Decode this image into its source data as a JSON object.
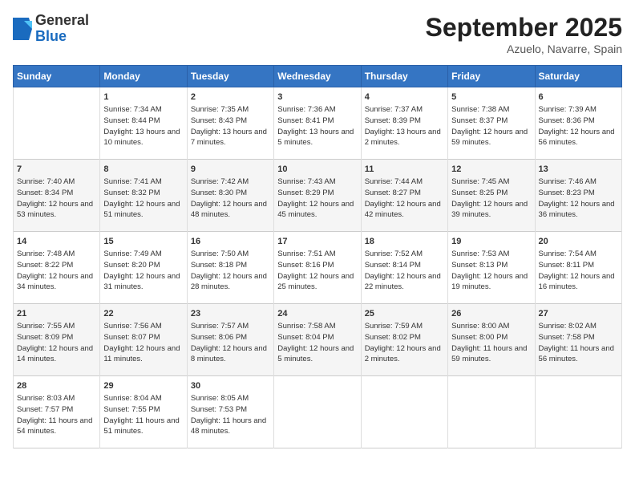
{
  "logo": {
    "general": "General",
    "blue": "Blue"
  },
  "header": {
    "month": "September 2025",
    "location": "Azuelo, Navarre, Spain"
  },
  "weekdays": [
    "Sunday",
    "Monday",
    "Tuesday",
    "Wednesday",
    "Thursday",
    "Friday",
    "Saturday"
  ],
  "weeks": [
    [
      {
        "day": "",
        "sunrise": "",
        "sunset": "",
        "daylight": ""
      },
      {
        "day": "1",
        "sunrise": "Sunrise: 7:34 AM",
        "sunset": "Sunset: 8:44 PM",
        "daylight": "Daylight: 13 hours and 10 minutes."
      },
      {
        "day": "2",
        "sunrise": "Sunrise: 7:35 AM",
        "sunset": "Sunset: 8:43 PM",
        "daylight": "Daylight: 13 hours and 7 minutes."
      },
      {
        "day": "3",
        "sunrise": "Sunrise: 7:36 AM",
        "sunset": "Sunset: 8:41 PM",
        "daylight": "Daylight: 13 hours and 5 minutes."
      },
      {
        "day": "4",
        "sunrise": "Sunrise: 7:37 AM",
        "sunset": "Sunset: 8:39 PM",
        "daylight": "Daylight: 13 hours and 2 minutes."
      },
      {
        "day": "5",
        "sunrise": "Sunrise: 7:38 AM",
        "sunset": "Sunset: 8:37 PM",
        "daylight": "Daylight: 12 hours and 59 minutes."
      },
      {
        "day": "6",
        "sunrise": "Sunrise: 7:39 AM",
        "sunset": "Sunset: 8:36 PM",
        "daylight": "Daylight: 12 hours and 56 minutes."
      }
    ],
    [
      {
        "day": "7",
        "sunrise": "Sunrise: 7:40 AM",
        "sunset": "Sunset: 8:34 PM",
        "daylight": "Daylight: 12 hours and 53 minutes."
      },
      {
        "day": "8",
        "sunrise": "Sunrise: 7:41 AM",
        "sunset": "Sunset: 8:32 PM",
        "daylight": "Daylight: 12 hours and 51 minutes."
      },
      {
        "day": "9",
        "sunrise": "Sunrise: 7:42 AM",
        "sunset": "Sunset: 8:30 PM",
        "daylight": "Daylight: 12 hours and 48 minutes."
      },
      {
        "day": "10",
        "sunrise": "Sunrise: 7:43 AM",
        "sunset": "Sunset: 8:29 PM",
        "daylight": "Daylight: 12 hours and 45 minutes."
      },
      {
        "day": "11",
        "sunrise": "Sunrise: 7:44 AM",
        "sunset": "Sunset: 8:27 PM",
        "daylight": "Daylight: 12 hours and 42 minutes."
      },
      {
        "day": "12",
        "sunrise": "Sunrise: 7:45 AM",
        "sunset": "Sunset: 8:25 PM",
        "daylight": "Daylight: 12 hours and 39 minutes."
      },
      {
        "day": "13",
        "sunrise": "Sunrise: 7:46 AM",
        "sunset": "Sunset: 8:23 PM",
        "daylight": "Daylight: 12 hours and 36 minutes."
      }
    ],
    [
      {
        "day": "14",
        "sunrise": "Sunrise: 7:48 AM",
        "sunset": "Sunset: 8:22 PM",
        "daylight": "Daylight: 12 hours and 34 minutes."
      },
      {
        "day": "15",
        "sunrise": "Sunrise: 7:49 AM",
        "sunset": "Sunset: 8:20 PM",
        "daylight": "Daylight: 12 hours and 31 minutes."
      },
      {
        "day": "16",
        "sunrise": "Sunrise: 7:50 AM",
        "sunset": "Sunset: 8:18 PM",
        "daylight": "Daylight: 12 hours and 28 minutes."
      },
      {
        "day": "17",
        "sunrise": "Sunrise: 7:51 AM",
        "sunset": "Sunset: 8:16 PM",
        "daylight": "Daylight: 12 hours and 25 minutes."
      },
      {
        "day": "18",
        "sunrise": "Sunrise: 7:52 AM",
        "sunset": "Sunset: 8:14 PM",
        "daylight": "Daylight: 12 hours and 22 minutes."
      },
      {
        "day": "19",
        "sunrise": "Sunrise: 7:53 AM",
        "sunset": "Sunset: 8:13 PM",
        "daylight": "Daylight: 12 hours and 19 minutes."
      },
      {
        "day": "20",
        "sunrise": "Sunrise: 7:54 AM",
        "sunset": "Sunset: 8:11 PM",
        "daylight": "Daylight: 12 hours and 16 minutes."
      }
    ],
    [
      {
        "day": "21",
        "sunrise": "Sunrise: 7:55 AM",
        "sunset": "Sunset: 8:09 PM",
        "daylight": "Daylight: 12 hours and 14 minutes."
      },
      {
        "day": "22",
        "sunrise": "Sunrise: 7:56 AM",
        "sunset": "Sunset: 8:07 PM",
        "daylight": "Daylight: 12 hours and 11 minutes."
      },
      {
        "day": "23",
        "sunrise": "Sunrise: 7:57 AM",
        "sunset": "Sunset: 8:06 PM",
        "daylight": "Daylight: 12 hours and 8 minutes."
      },
      {
        "day": "24",
        "sunrise": "Sunrise: 7:58 AM",
        "sunset": "Sunset: 8:04 PM",
        "daylight": "Daylight: 12 hours and 5 minutes."
      },
      {
        "day": "25",
        "sunrise": "Sunrise: 7:59 AM",
        "sunset": "Sunset: 8:02 PM",
        "daylight": "Daylight: 12 hours and 2 minutes."
      },
      {
        "day": "26",
        "sunrise": "Sunrise: 8:00 AM",
        "sunset": "Sunset: 8:00 PM",
        "daylight": "Daylight: 11 hours and 59 minutes."
      },
      {
        "day": "27",
        "sunrise": "Sunrise: 8:02 AM",
        "sunset": "Sunset: 7:58 PM",
        "daylight": "Daylight: 11 hours and 56 minutes."
      }
    ],
    [
      {
        "day": "28",
        "sunrise": "Sunrise: 8:03 AM",
        "sunset": "Sunset: 7:57 PM",
        "daylight": "Daylight: 11 hours and 54 minutes."
      },
      {
        "day": "29",
        "sunrise": "Sunrise: 8:04 AM",
        "sunset": "Sunset: 7:55 PM",
        "daylight": "Daylight: 11 hours and 51 minutes."
      },
      {
        "day": "30",
        "sunrise": "Sunrise: 8:05 AM",
        "sunset": "Sunset: 7:53 PM",
        "daylight": "Daylight: 11 hours and 48 minutes."
      },
      {
        "day": "",
        "sunrise": "",
        "sunset": "",
        "daylight": ""
      },
      {
        "day": "",
        "sunrise": "",
        "sunset": "",
        "daylight": ""
      },
      {
        "day": "",
        "sunrise": "",
        "sunset": "",
        "daylight": ""
      },
      {
        "day": "",
        "sunrise": "",
        "sunset": "",
        "daylight": ""
      }
    ]
  ]
}
